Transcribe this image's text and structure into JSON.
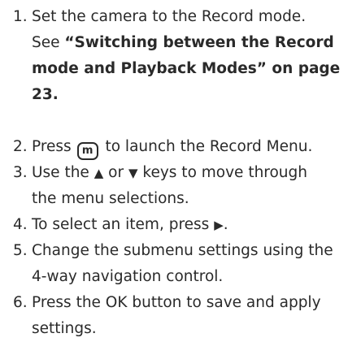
{
  "steps": [
    {
      "num": "1.",
      "line1": "Set the camera to the Record mode.",
      "line2_prefix": "See ",
      "line2_bold": "“Switching between the Record",
      "line3_bold": "mode and Playback Modes” on page",
      "line4_bold": "23."
    },
    {
      "num": "2.",
      "pre": "Press",
      "key": "m",
      "post": "to launch the Record Menu."
    },
    {
      "num": "3.",
      "pre": "Use the",
      "up": "▲",
      "mid": "or",
      "down": "▼",
      "post": "keys to move through",
      "line2": "the menu selections."
    },
    {
      "num": "4.",
      "pre": "To select an item, press",
      "right": "▶",
      "post": "."
    },
    {
      "num": "5.",
      "line1": "Change the submenu settings using the",
      "line2": "4-way navigation control."
    },
    {
      "num": "6.",
      "line1": "Press the OK button to save and apply",
      "line2": "settings."
    }
  ]
}
